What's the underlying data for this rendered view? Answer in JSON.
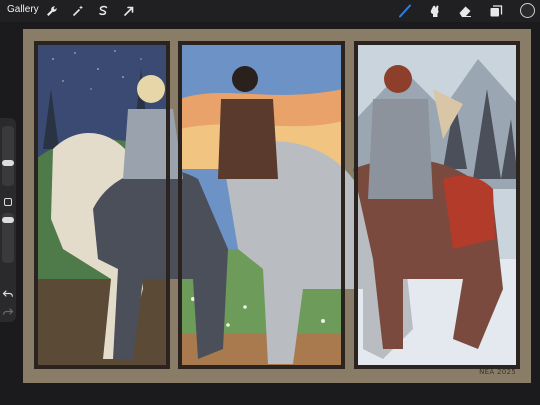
{
  "toolbar": {
    "gallery_label": "Gallery",
    "left_tools": [
      "wrench-icon",
      "magic-wand-icon",
      "selection-icon",
      "transform-arrow-icon"
    ],
    "right_tools": [
      "brush-icon",
      "smudge-icon",
      "eraser-icon",
      "layers-icon"
    ],
    "active_tool": "brush-icon",
    "active_color": "#2f7fe6",
    "current_color": "#2a2a2c"
  },
  "canvas": {
    "signature": "NEA 2025",
    "colors": {
      "background": "#8a7d67",
      "frame": "#2b2320",
      "sky_night": "#3a4a72",
      "sky_sunset": "#e9a36a",
      "sky_winter": "#c9d4dc",
      "horse_dapple": "#b9bcc0",
      "horse_dark": "#4b4f5a",
      "horse_cream": "#e4dccb"
    }
  }
}
